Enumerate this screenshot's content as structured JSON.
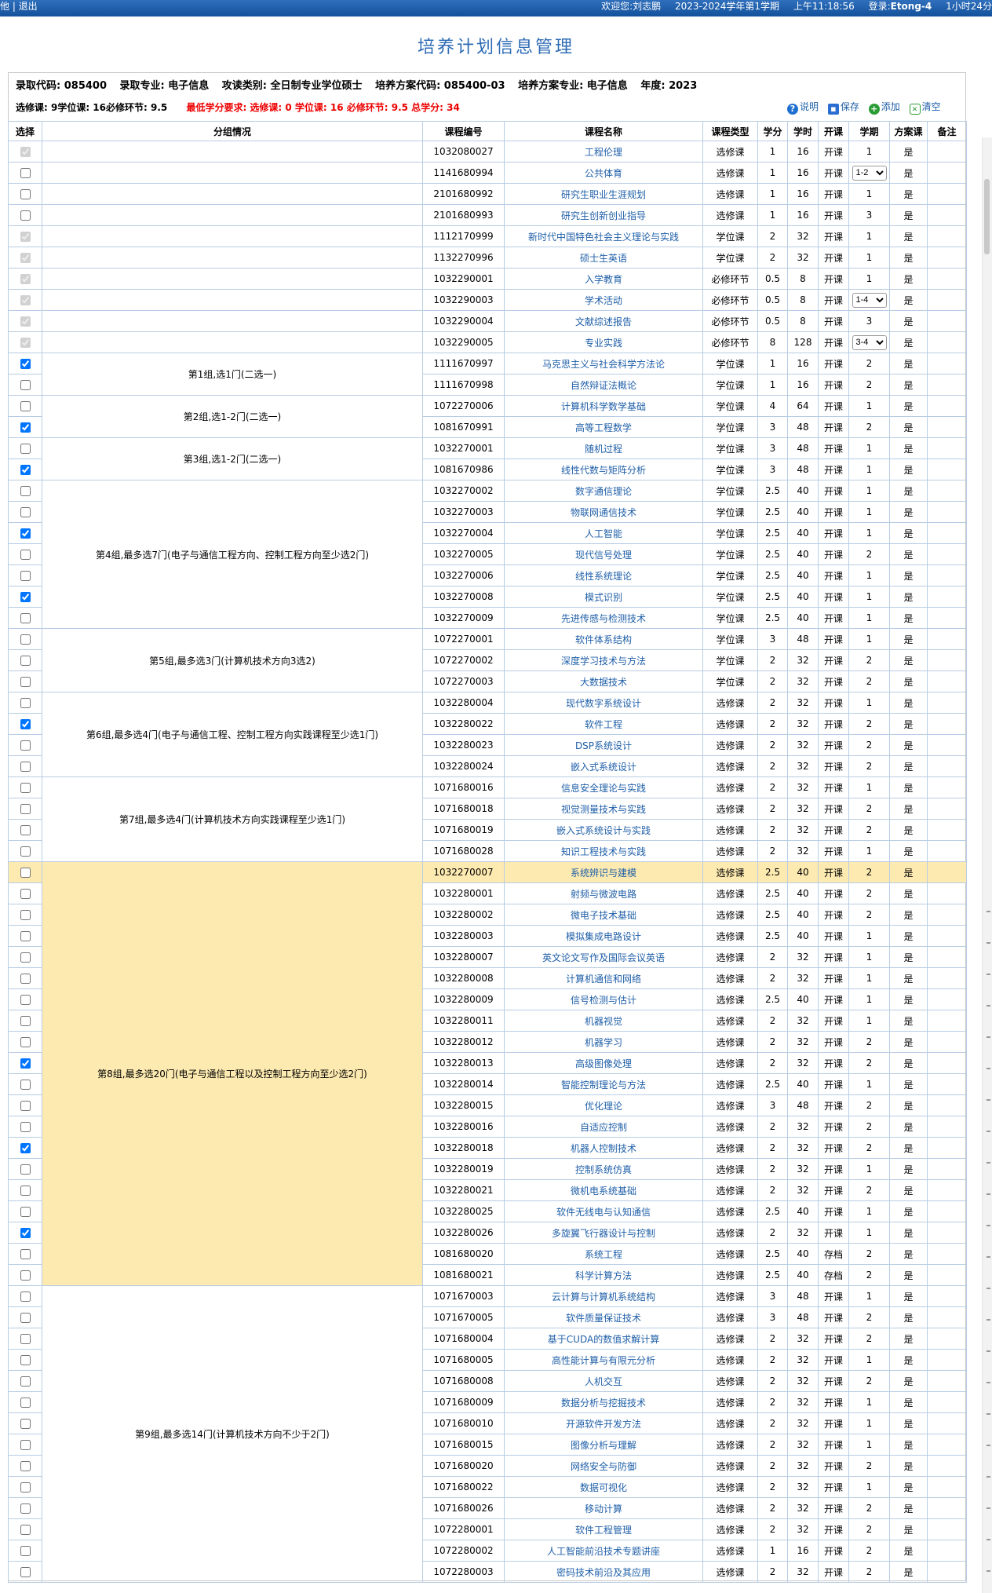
{
  "topbar": {
    "left": "他 | 退出",
    "welcome": "欢迎您:刘志鹏",
    "term": "2023-2024学年第1学期",
    "time": "上午11:18:56",
    "login_label": "登录:",
    "login_user": "Etong-4",
    "duration": "1小时24分"
  },
  "page_title": "培养计划信息管理",
  "info": {
    "l1": [
      "录取代码: 085400",
      "录取专业: 电子信息",
      "攻读类别: 全日制专业学位硕士",
      "培养方案代码: 085400-03",
      "培养方案专业: 电子信息",
      "年度: 2023"
    ],
    "l2": "选修课: 9学位课: 16必修环节: 9.5",
    "l2_red": "最低学分要求: 选修课: 0 学位课: 16 必修环节: 9.5 总学分: 34"
  },
  "actions": {
    "help": "说明",
    "save": "保存",
    "add": "添加",
    "clear": "清空"
  },
  "headers": [
    "选择",
    "分组情况",
    "课程编号",
    "课程名称",
    "课程类型",
    "学分",
    "学时",
    "开课",
    "学期",
    "方案课",
    "备注"
  ],
  "rows": [
    {
      "code": "1032080027",
      "name": "工程伦理",
      "type": "选修课",
      "credit": "1",
      "hours": "16",
      "open": "开课",
      "term": "1",
      "plan": "是",
      "c": "d",
      "g": ""
    },
    {
      "code": "1141680994",
      "name": "公共体育",
      "type": "选修课",
      "credit": "1",
      "hours": "16",
      "open": "开课",
      "term": "1-2",
      "plan": "是",
      "c": "0",
      "g": "",
      "sel": true
    },
    {
      "code": "2101680992",
      "name": "研究生职业生涯规划",
      "type": "选修课",
      "credit": "1",
      "hours": "16",
      "open": "开课",
      "term": "1",
      "plan": "是",
      "c": "0",
      "g": ""
    },
    {
      "code": "2101680993",
      "name": "研究生创新创业指导",
      "type": "选修课",
      "credit": "1",
      "hours": "16",
      "open": "开课",
      "term": "3",
      "plan": "是",
      "c": "0",
      "g": ""
    },
    {
      "code": "1112170999",
      "name": "新时代中国特色社会主义理论与实践",
      "type": "学位课",
      "credit": "2",
      "hours": "32",
      "open": "开课",
      "term": "1",
      "plan": "是",
      "c": "d",
      "g": ""
    },
    {
      "code": "1132270996",
      "name": "硕士生英语",
      "type": "学位课",
      "credit": "2",
      "hours": "32",
      "open": "开课",
      "term": "1",
      "plan": "是",
      "c": "d",
      "g": ""
    },
    {
      "code": "1032290001",
      "name": "入学教育",
      "type": "必修环节",
      "credit": "0.5",
      "hours": "8",
      "open": "开课",
      "term": "1",
      "plan": "是",
      "c": "d",
      "g": ""
    },
    {
      "code": "1032290003",
      "name": "学术活动",
      "type": "必修环节",
      "credit": "0.5",
      "hours": "8",
      "open": "开课",
      "term": "1-4",
      "plan": "是",
      "c": "d",
      "g": "",
      "sel": true
    },
    {
      "code": "1032290004",
      "name": "文献综述报告",
      "type": "必修环节",
      "credit": "0.5",
      "hours": "8",
      "open": "开课",
      "term": "3",
      "plan": "是",
      "c": "d",
      "g": ""
    },
    {
      "code": "1032290005",
      "name": "专业实践",
      "type": "必修环节",
      "credit": "8",
      "hours": "128",
      "open": "开课",
      "term": "3-4",
      "plan": "是",
      "c": "d",
      "g": "",
      "sel": true
    },
    {
      "code": "1111670997",
      "name": "马克思主义与社会科学方法论",
      "type": "学位课",
      "credit": "1",
      "hours": "16",
      "open": "开课",
      "term": "2",
      "plan": "是",
      "c": "1",
      "g": "第1组,选1门(二选一)",
      "gs": 2
    },
    {
      "code": "1111670998",
      "name": "自然辩证法概论",
      "type": "学位课",
      "credit": "1",
      "hours": "16",
      "open": "开课",
      "term": "2",
      "plan": "是",
      "c": "0"
    },
    {
      "code": "1072270006",
      "name": "计算机科学数学基础",
      "type": "学位课",
      "credit": "4",
      "hours": "64",
      "open": "开课",
      "term": "1",
      "plan": "是",
      "c": "0",
      "g": "第2组,选1-2门(二选一)",
      "gs": 2
    },
    {
      "code": "1081670991",
      "name": "高等工程数学",
      "type": "学位课",
      "credit": "3",
      "hours": "48",
      "open": "开课",
      "term": "2",
      "plan": "是",
      "c": "1"
    },
    {
      "code": "1032270001",
      "name": "随机过程",
      "type": "学位课",
      "credit": "3",
      "hours": "48",
      "open": "开课",
      "term": "1",
      "plan": "是",
      "c": "0",
      "g": "第3组,选1-2门(二选一)",
      "gs": 2
    },
    {
      "code": "1081670986",
      "name": "线性代数与矩阵分析",
      "type": "学位课",
      "credit": "3",
      "hours": "48",
      "open": "开课",
      "term": "1",
      "plan": "是",
      "c": "1"
    },
    {
      "code": "1032270002",
      "name": "数字通信理论",
      "type": "学位课",
      "credit": "2.5",
      "hours": "40",
      "open": "开课",
      "term": "1",
      "plan": "是",
      "c": "0",
      "g": "第4组,最多选7门(电子与通信工程方向、控制工程方向至少选2门)",
      "gs": 7
    },
    {
      "code": "1032270003",
      "name": "物联网通信技术",
      "type": "学位课",
      "credit": "2.5",
      "hours": "40",
      "open": "开课",
      "term": "1",
      "plan": "是",
      "c": "0"
    },
    {
      "code": "1032270004",
      "name": "人工智能",
      "type": "学位课",
      "credit": "2.5",
      "hours": "40",
      "open": "开课",
      "term": "1",
      "plan": "是",
      "c": "1"
    },
    {
      "code": "1032270005",
      "name": "现代信号处理",
      "type": "学位课",
      "credit": "2.5",
      "hours": "40",
      "open": "开课",
      "term": "2",
      "plan": "是",
      "c": "0"
    },
    {
      "code": "1032270006",
      "name": "线性系统理论",
      "type": "学位课",
      "credit": "2.5",
      "hours": "40",
      "open": "开课",
      "term": "1",
      "plan": "是",
      "c": "0"
    },
    {
      "code": "1032270008",
      "name": "模式识别",
      "type": "学位课",
      "credit": "2.5",
      "hours": "40",
      "open": "开课",
      "term": "1",
      "plan": "是",
      "c": "1"
    },
    {
      "code": "1032270009",
      "name": "先进传感与检测技术",
      "type": "学位课",
      "credit": "2.5",
      "hours": "40",
      "open": "开课",
      "term": "1",
      "plan": "是",
      "c": "0"
    },
    {
      "code": "1072270001",
      "name": "软件体系结构",
      "type": "学位课",
      "credit": "3",
      "hours": "48",
      "open": "开课",
      "term": "1",
      "plan": "是",
      "c": "0",
      "g": "第5组,最多选3门(计算机技术方向3选2)",
      "gs": 3
    },
    {
      "code": "1072270002",
      "name": "深度学习技术与方法",
      "type": "学位课",
      "credit": "2",
      "hours": "32",
      "open": "开课",
      "term": "2",
      "plan": "是",
      "c": "0"
    },
    {
      "code": "1072270003",
      "name": "大数据技术",
      "type": "学位课",
      "credit": "2",
      "hours": "32",
      "open": "开课",
      "term": "2",
      "plan": "是",
      "c": "0"
    },
    {
      "code": "1032280004",
      "name": "现代数字系统设计",
      "type": "选修课",
      "credit": "2",
      "hours": "32",
      "open": "开课",
      "term": "1",
      "plan": "是",
      "c": "0",
      "g": "第6组,最多选4门(电子与通信工程、控制工程方向实践课程至少选1门)",
      "gs": 4
    },
    {
      "code": "1032280022",
      "name": "软件工程",
      "type": "选修课",
      "credit": "2",
      "hours": "32",
      "open": "开课",
      "term": "2",
      "plan": "是",
      "c": "1"
    },
    {
      "code": "1032280023",
      "name": "DSP系统设计",
      "type": "选修课",
      "credit": "2",
      "hours": "32",
      "open": "开课",
      "term": "2",
      "plan": "是",
      "c": "0"
    },
    {
      "code": "1032280024",
      "name": "嵌入式系统设计",
      "type": "选修课",
      "credit": "2",
      "hours": "32",
      "open": "开课",
      "term": "2",
      "plan": "是",
      "c": "0"
    },
    {
      "code": "1071680016",
      "name": "信息安全理论与实践",
      "type": "选修课",
      "credit": "2",
      "hours": "32",
      "open": "开课",
      "term": "1",
      "plan": "是",
      "c": "0",
      "g": "第7组,最多选4门(计算机技术方向实践课程至少选1门)",
      "gs": 4
    },
    {
      "code": "1071680018",
      "name": "视觉测量技术与实践",
      "type": "选修课",
      "credit": "2",
      "hours": "32",
      "open": "开课",
      "term": "2",
      "plan": "是",
      "c": "0"
    },
    {
      "code": "1071680019",
      "name": "嵌入式系统设计与实践",
      "type": "选修课",
      "credit": "2",
      "hours": "32",
      "open": "开课",
      "term": "2",
      "plan": "是",
      "c": "0"
    },
    {
      "code": "1071680028",
      "name": "知识工程技术与实践",
      "type": "选修课",
      "credit": "2",
      "hours": "32",
      "open": "开课",
      "term": "1",
      "plan": "是",
      "c": "0"
    },
    {
      "code": "1032270007",
      "name": "系统辨识与建模",
      "type": "选修课",
      "credit": "2.5",
      "hours": "40",
      "open": "开课",
      "term": "2",
      "plan": "是",
      "c": "0",
      "g": "第8组,最多选20门(电子与通信工程以及控制工程方向至少选2门)",
      "gs": 20,
      "hl": true
    },
    {
      "code": "1032280001",
      "name": "射频与微波电路",
      "type": "选修课",
      "credit": "2.5",
      "hours": "40",
      "open": "开课",
      "term": "2",
      "plan": "是",
      "c": "0"
    },
    {
      "code": "1032280002",
      "name": "微电子技术基础",
      "type": "选修课",
      "credit": "2.5",
      "hours": "40",
      "open": "开课",
      "term": "2",
      "plan": "是",
      "c": "0"
    },
    {
      "code": "1032280003",
      "name": "模拟集成电路设计",
      "type": "选修课",
      "credit": "2.5",
      "hours": "40",
      "open": "开课",
      "term": "1",
      "plan": "是",
      "c": "0"
    },
    {
      "code": "1032280007",
      "name": "英文论文写作及国际会议英语",
      "type": "选修课",
      "credit": "2",
      "hours": "32",
      "open": "开课",
      "term": "1",
      "plan": "是",
      "c": "0"
    },
    {
      "code": "1032280008",
      "name": "计算机通信和网络",
      "type": "选修课",
      "credit": "2",
      "hours": "32",
      "open": "开课",
      "term": "1",
      "plan": "是",
      "c": "0"
    },
    {
      "code": "1032280009",
      "name": "信号检测与估计",
      "type": "选修课",
      "credit": "2.5",
      "hours": "40",
      "open": "开课",
      "term": "1",
      "plan": "是",
      "c": "0"
    },
    {
      "code": "1032280011",
      "name": "机器视觉",
      "type": "选修课",
      "credit": "2",
      "hours": "32",
      "open": "开课",
      "term": "1",
      "plan": "是",
      "c": "0"
    },
    {
      "code": "1032280012",
      "name": "机器学习",
      "type": "选修课",
      "credit": "2",
      "hours": "32",
      "open": "开课",
      "term": "2",
      "plan": "是",
      "c": "0"
    },
    {
      "code": "1032280013",
      "name": "高级图像处理",
      "type": "选修课",
      "credit": "2",
      "hours": "32",
      "open": "开课",
      "term": "2",
      "plan": "是",
      "c": "1"
    },
    {
      "code": "1032280014",
      "name": "智能控制理论与方法",
      "type": "选修课",
      "credit": "2.5",
      "hours": "40",
      "open": "开课",
      "term": "1",
      "plan": "是",
      "c": "0"
    },
    {
      "code": "1032280015",
      "name": "优化理论",
      "type": "选修课",
      "credit": "3",
      "hours": "48",
      "open": "开课",
      "term": "2",
      "plan": "是",
      "c": "0"
    },
    {
      "code": "1032280016",
      "name": "自适应控制",
      "type": "选修课",
      "credit": "2",
      "hours": "32",
      "open": "开课",
      "term": "2",
      "plan": "是",
      "c": "0"
    },
    {
      "code": "1032280018",
      "name": "机器人控制技术",
      "type": "选修课",
      "credit": "2",
      "hours": "32",
      "open": "开课",
      "term": "2",
      "plan": "是",
      "c": "1"
    },
    {
      "code": "1032280019",
      "name": "控制系统仿真",
      "type": "选修课",
      "credit": "2",
      "hours": "32",
      "open": "开课",
      "term": "1",
      "plan": "是",
      "c": "0"
    },
    {
      "code": "1032280021",
      "name": "微机电系统基础",
      "type": "选修课",
      "credit": "2",
      "hours": "32",
      "open": "开课",
      "term": "2",
      "plan": "是",
      "c": "0"
    },
    {
      "code": "1032280025",
      "name": "软件无线电与认知通信",
      "type": "选修课",
      "credit": "2.5",
      "hours": "40",
      "open": "开课",
      "term": "1",
      "plan": "是",
      "c": "0"
    },
    {
      "code": "1032280026",
      "name": "多旋翼飞行器设计与控制",
      "type": "选修课",
      "credit": "2",
      "hours": "32",
      "open": "开课",
      "term": "1",
      "plan": "是",
      "c": "1"
    },
    {
      "code": "1081680020",
      "name": "系统工程",
      "type": "选修课",
      "credit": "2.5",
      "hours": "40",
      "open": "存档",
      "term": "2",
      "plan": "是",
      "c": "0"
    },
    {
      "code": "1081680021",
      "name": "科学计算方法",
      "type": "选修课",
      "credit": "2.5",
      "hours": "40",
      "open": "存档",
      "term": "2",
      "plan": "是",
      "c": "0"
    },
    {
      "code": "1071670003",
      "name": "云计算与计算机系统结构",
      "type": "选修课",
      "credit": "3",
      "hours": "48",
      "open": "开课",
      "term": "1",
      "plan": "是",
      "c": "0",
      "g": "第9组,最多选14门(计算机技术方向不少于2门)",
      "gs": 14
    },
    {
      "code": "1071670005",
      "name": "软件质量保证技术",
      "type": "选修课",
      "credit": "3",
      "hours": "48",
      "open": "开课",
      "term": "2",
      "plan": "是",
      "c": "0"
    },
    {
      "code": "1071680004",
      "name": "基于CUDA的数值求解计算",
      "type": "选修课",
      "credit": "2",
      "hours": "32",
      "open": "开课",
      "term": "2",
      "plan": "是",
      "c": "0"
    },
    {
      "code": "1071680005",
      "name": "高性能计算与有限元分析",
      "type": "选修课",
      "credit": "2",
      "hours": "32",
      "open": "开课",
      "term": "1",
      "plan": "是",
      "c": "0"
    },
    {
      "code": "1071680008",
      "name": "人机交互",
      "type": "选修课",
      "credit": "2",
      "hours": "32",
      "open": "开课",
      "term": "2",
      "plan": "是",
      "c": "0"
    },
    {
      "code": "1071680009",
      "name": "数据分析与挖掘技术",
      "type": "选修课",
      "credit": "2",
      "hours": "32",
      "open": "开课",
      "term": "1",
      "plan": "是",
      "c": "0"
    },
    {
      "code": "1071680010",
      "name": "开源软件开发方法",
      "type": "选修课",
      "credit": "2",
      "hours": "32",
      "open": "开课",
      "term": "1",
      "plan": "是",
      "c": "0"
    },
    {
      "code": "1071680015",
      "name": "图像分析与理解",
      "type": "选修课",
      "credit": "2",
      "hours": "32",
      "open": "开课",
      "term": "1",
      "plan": "是",
      "c": "0"
    },
    {
      "code": "1071680020",
      "name": "网络安全与防御",
      "type": "选修课",
      "credit": "2",
      "hours": "32",
      "open": "开课",
      "term": "2",
      "plan": "是",
      "c": "0"
    },
    {
      "code": "1071680022",
      "name": "数据可视化",
      "type": "选修课",
      "credit": "2",
      "hours": "32",
      "open": "开课",
      "term": "1",
      "plan": "是",
      "c": "0"
    },
    {
      "code": "1071680026",
      "name": "移动计算",
      "type": "选修课",
      "credit": "2",
      "hours": "32",
      "open": "开课",
      "term": "2",
      "plan": "是",
      "c": "0"
    },
    {
      "code": "1072280001",
      "name": "软件工程管理",
      "type": "选修课",
      "credit": "2",
      "hours": "32",
      "open": "开课",
      "term": "2",
      "plan": "是",
      "c": "0"
    },
    {
      "code": "1072280002",
      "name": "人工智能前沿技术专题讲座",
      "type": "选修课",
      "credit": "1",
      "hours": "16",
      "open": "开课",
      "term": "2",
      "plan": "是",
      "c": "0"
    },
    {
      "code": "1072280003",
      "name": "密码技术前沿及其应用",
      "type": "选修课",
      "credit": "2",
      "hours": "32",
      "open": "开课",
      "term": "2",
      "plan": "是",
      "c": "0"
    }
  ]
}
